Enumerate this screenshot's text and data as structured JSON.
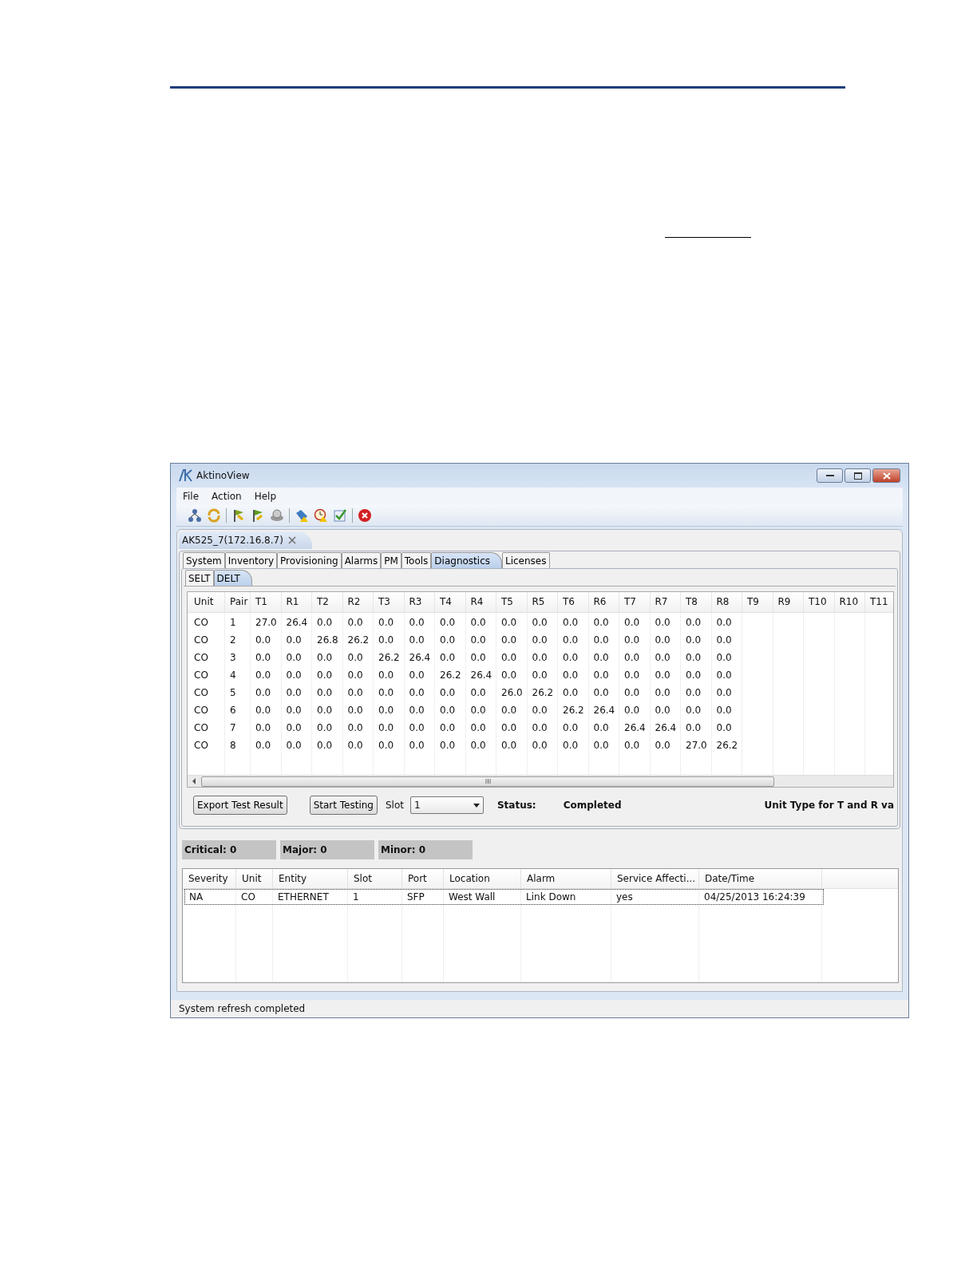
{
  "window": {
    "title": "AktinoView"
  },
  "menu": [
    "File",
    "Action",
    "Help"
  ],
  "document_tab": {
    "label": "AK525_7(172.16.8.7)"
  },
  "tabs": [
    {
      "label": "System",
      "selected": false
    },
    {
      "label": "Inventory",
      "selected": false
    },
    {
      "label": "Provisioning",
      "selected": false
    },
    {
      "label": "Alarms",
      "selected": false
    },
    {
      "label": "PM",
      "selected": false
    },
    {
      "label": "Tools",
      "selected": false
    },
    {
      "label": "Diagnostics",
      "selected": true
    },
    {
      "label": "Licenses",
      "selected": false
    }
  ],
  "subtabs": [
    {
      "label": "SELT",
      "selected": false
    },
    {
      "label": "DELT",
      "selected": true
    }
  ],
  "results": {
    "columns": [
      "Unit",
      "Pair",
      "T1",
      "R1",
      "T2",
      "R2",
      "T3",
      "R3",
      "T4",
      "R4",
      "T5",
      "R5",
      "T6",
      "R6",
      "T7",
      "R7",
      "T8",
      "R8",
      "T9",
      "R9",
      "T10",
      "R10",
      "T11"
    ],
    "rows": [
      [
        "CO",
        "1",
        "27.0",
        "26.4",
        "0.0",
        "0.0",
        "0.0",
        "0.0",
        "0.0",
        "0.0",
        "0.0",
        "0.0",
        "0.0",
        "0.0",
        "0.0",
        "0.0",
        "0.0",
        "0.0"
      ],
      [
        "CO",
        "2",
        "0.0",
        "0.0",
        "26.8",
        "26.2",
        "0.0",
        "0.0",
        "0.0",
        "0.0",
        "0.0",
        "0.0",
        "0.0",
        "0.0",
        "0.0",
        "0.0",
        "0.0",
        "0.0"
      ],
      [
        "CO",
        "3",
        "0.0",
        "0.0",
        "0.0",
        "0.0",
        "26.2",
        "26.4",
        "0.0",
        "0.0",
        "0.0",
        "0.0",
        "0.0",
        "0.0",
        "0.0",
        "0.0",
        "0.0",
        "0.0"
      ],
      [
        "CO",
        "4",
        "0.0",
        "0.0",
        "0.0",
        "0.0",
        "0.0",
        "0.0",
        "26.2",
        "26.4",
        "0.0",
        "0.0",
        "0.0",
        "0.0",
        "0.0",
        "0.0",
        "0.0",
        "0.0"
      ],
      [
        "CO",
        "5",
        "0.0",
        "0.0",
        "0.0",
        "0.0",
        "0.0",
        "0.0",
        "0.0",
        "0.0",
        "26.0",
        "26.2",
        "0.0",
        "0.0",
        "0.0",
        "0.0",
        "0.0",
        "0.0"
      ],
      [
        "CO",
        "6",
        "0.0",
        "0.0",
        "0.0",
        "0.0",
        "0.0",
        "0.0",
        "0.0",
        "0.0",
        "0.0",
        "0.0",
        "26.2",
        "26.4",
        "0.0",
        "0.0",
        "0.0",
        "0.0"
      ],
      [
        "CO",
        "7",
        "0.0",
        "0.0",
        "0.0",
        "0.0",
        "0.0",
        "0.0",
        "0.0",
        "0.0",
        "0.0",
        "0.0",
        "0.0",
        "0.0",
        "26.4",
        "26.4",
        "0.0",
        "0.0"
      ],
      [
        "CO",
        "8",
        "0.0",
        "0.0",
        "0.0",
        "0.0",
        "0.0",
        "0.0",
        "0.0",
        "0.0",
        "0.0",
        "0.0",
        "0.0",
        "0.0",
        "0.0",
        "0.0",
        "27.0",
        "26.2"
      ]
    ]
  },
  "controls": {
    "export_button": "Export Test Result",
    "start_button": "Start Testing",
    "slot_label": "Slot",
    "slot_value": "1",
    "status_label": "Status:",
    "status_value": "Completed",
    "unit_type_label": "Unit Type for T and R va"
  },
  "alarm_counts": [
    "Critical: 0",
    "Major: 0",
    "Minor: 0"
  ],
  "alarms": {
    "columns": [
      "Severity",
      "Unit",
      "Entity",
      "Slot",
      "Port",
      "Location",
      "Alarm",
      "Service Affecti...",
      "Date/Time"
    ],
    "rows": [
      {
        "cells": [
          "NA",
          "CO",
          "ETHERNET",
          "1",
          "SFP",
          "West Wall",
          "Link Down",
          "yes",
          "04/25/2013 16:24:39"
        ],
        "selected": true
      }
    ]
  },
  "status_bar": "System refresh completed"
}
